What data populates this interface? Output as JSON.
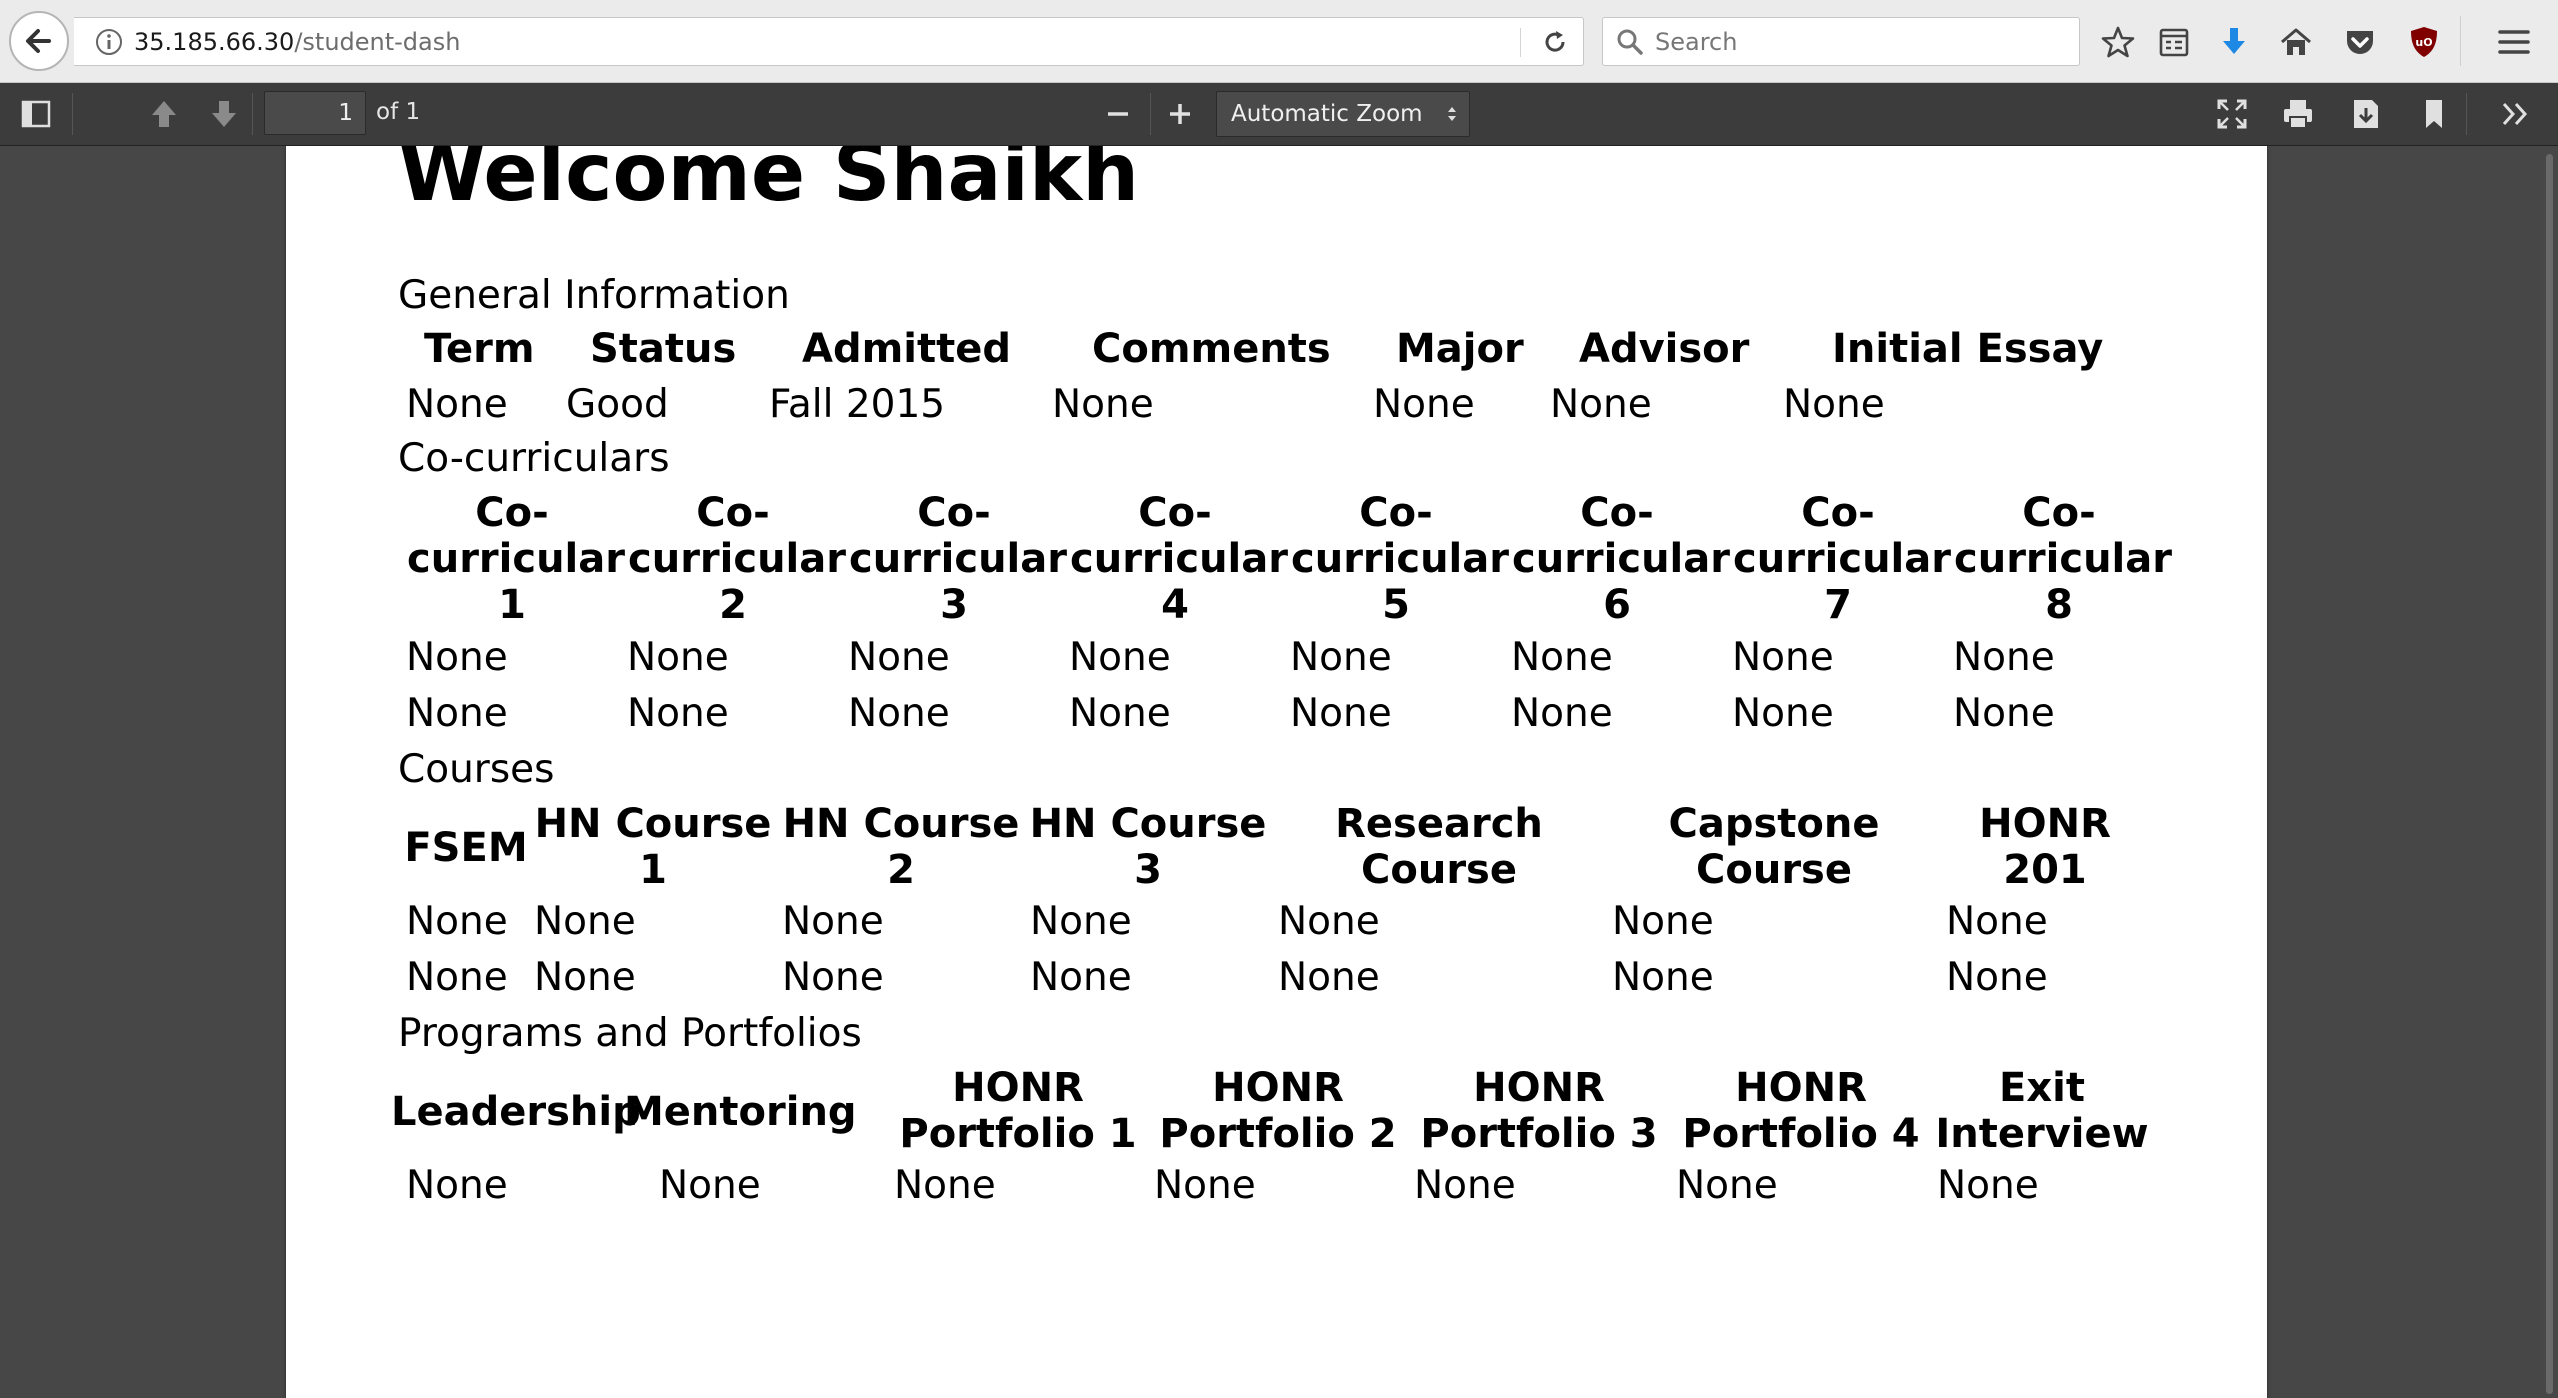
{
  "browser": {
    "url_host": "35.185.66.30",
    "url_path": "/student-dash",
    "search_placeholder": "Search"
  },
  "pdf_toolbar": {
    "page_number": "1",
    "page_of": "of 1",
    "zoom_label": "Automatic Zoom"
  },
  "document": {
    "title": "Welcome Shaikh",
    "general": {
      "section_label": "General Information",
      "headers": [
        "Term",
        "Status",
        "Admitted",
        "Comments",
        "Major",
        "Advisor",
        "Initial Essay"
      ],
      "row": [
        "None",
        "Good",
        "Fall 2015",
        "None",
        "None",
        "None",
        "None"
      ]
    },
    "cocurriculars": {
      "section_label": "Co-curriculars",
      "headers": [
        [
          "Co-",
          "curricular",
          "1"
        ],
        [
          "Co-",
          "curricular",
          "2"
        ],
        [
          "Co-",
          "curricular",
          "3"
        ],
        [
          "Co-",
          "curricular",
          "4"
        ],
        [
          "Co-",
          "curricular",
          "5"
        ],
        [
          "Co-",
          "curricular",
          "6"
        ],
        [
          "Co-",
          "curricular",
          "7"
        ],
        [
          "Co-",
          "curricular",
          "8"
        ]
      ],
      "rows": [
        [
          "None",
          "None",
          "None",
          "None",
          "None",
          "None",
          "None",
          "None"
        ],
        [
          "None",
          "None",
          "None",
          "None",
          "None",
          "None",
          "None",
          "None"
        ]
      ]
    },
    "courses": {
      "section_label": "Courses",
      "headers": [
        [
          "FSEM"
        ],
        [
          "HN Course",
          "1"
        ],
        [
          "HN Course",
          "2"
        ],
        [
          "HN Course",
          "3"
        ],
        [
          "Research",
          "Course"
        ],
        [
          "Capstone",
          "Course"
        ],
        [
          "HONR",
          "201"
        ]
      ],
      "rows": [
        [
          "None",
          "None",
          "None",
          "None",
          "None",
          "None",
          "None"
        ],
        [
          "None",
          "None",
          "None",
          "None",
          "None",
          "None",
          "None"
        ]
      ]
    },
    "programs": {
      "section_label": "Programs and Portfolios",
      "headers": [
        [
          "Leadership"
        ],
        [
          "Mentoring"
        ],
        [
          "HONR",
          "Portfolio 1"
        ],
        [
          "HONR",
          "Portfolio 2"
        ],
        [
          "HONR",
          "Portfolio 3"
        ],
        [
          "HONR",
          "Portfolio 4"
        ],
        [
          "Exit",
          "Interview"
        ]
      ],
      "row": [
        "None",
        "None",
        "None",
        "None",
        "None",
        "None",
        "None"
      ]
    }
  }
}
